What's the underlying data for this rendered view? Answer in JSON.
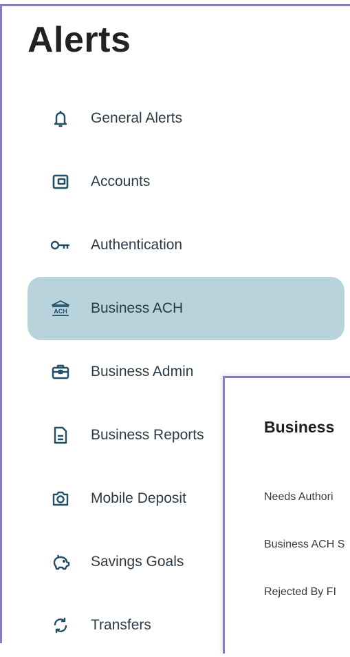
{
  "page": {
    "title": "Alerts"
  },
  "nav": {
    "items": [
      {
        "label": "General Alerts",
        "icon": "bell-icon"
      },
      {
        "label": "Accounts",
        "icon": "wallet-icon"
      },
      {
        "label": "Authentication",
        "icon": "key-icon"
      },
      {
        "label": "Business ACH",
        "icon": "ach-bank-icon",
        "active": true
      },
      {
        "label": "Business Admin",
        "icon": "briefcase-icon"
      },
      {
        "label": "Business Reports",
        "icon": "document-icon"
      },
      {
        "label": "Mobile Deposit",
        "icon": "camera-icon"
      },
      {
        "label": "Savings Goals",
        "icon": "piggy-bank-icon"
      },
      {
        "label": "Transfers",
        "icon": "transfer-arrows-icon"
      }
    ]
  },
  "panel": {
    "title": "Business",
    "rows": [
      "Needs Authori",
      "Business ACH S",
      "Rejected By FI"
    ]
  },
  "colors": {
    "active_bg": "#b9d3dc",
    "icon": "#1f4e66",
    "frame": "#8b7bb8"
  }
}
